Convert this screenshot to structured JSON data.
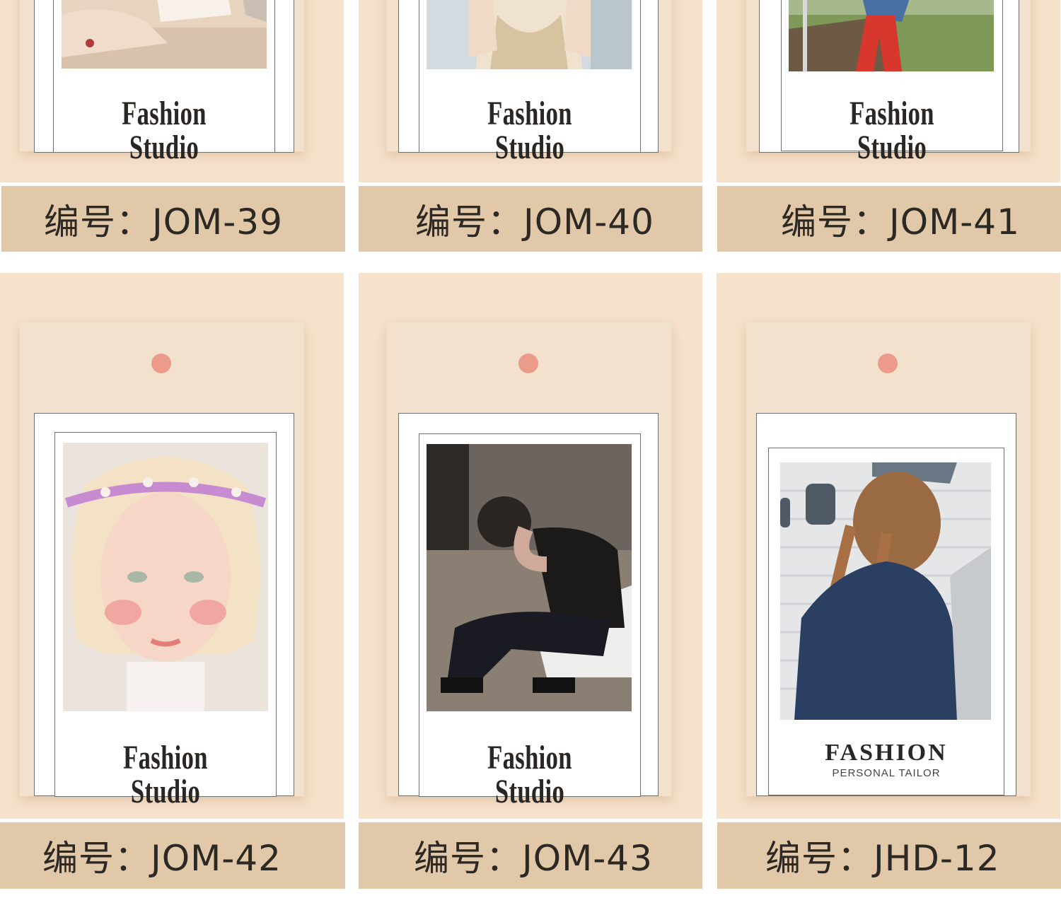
{
  "colors": {
    "cell_background": "#f6e1ca",
    "tag_background": "#f2e2cd",
    "code_bar": "#e1c8a8",
    "hole": "#ec9b8a",
    "text": "#2c2823"
  },
  "products": [
    {
      "code_label": "编号：JOM-39",
      "brand": "Fashion Studio",
      "photo": "girl-at-table-photo"
    },
    {
      "code_label": "编号：JOM-40",
      "brand": "Fashion Studio",
      "photo": "girl-beige-dress-photo"
    },
    {
      "code_label": "编号：JOM-41",
      "brand": "Fashion Studio",
      "photo": "child-red-pants-photo"
    },
    {
      "code_label": "编号：JOM-42",
      "brand": "Fashion Studio",
      "photo": "blonde-girl-flower-crown-photo"
    },
    {
      "code_label": "编号：JOM-43",
      "brand": "Fashion Studio",
      "photo": "boy-sitting-photo"
    },
    {
      "code_label": "编号：JHD-12",
      "brand_title": "FASHION",
      "brand_subtitle": "PERSONAL TAILOR",
      "photo": "girl-braids-denim-photo"
    }
  ]
}
